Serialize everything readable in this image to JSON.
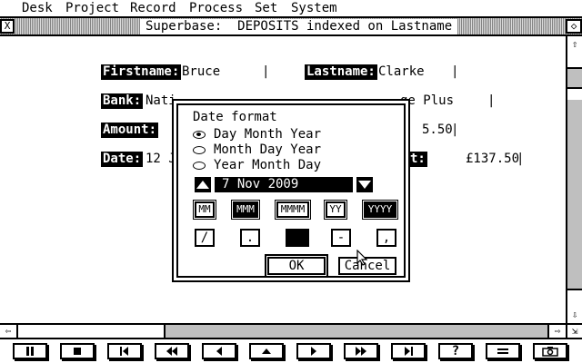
{
  "menubar": {
    "items": [
      "Desk",
      "Project",
      "Record",
      "Process",
      "Set",
      "System"
    ]
  },
  "window": {
    "title": "Superbase:  DEPOSITS indexed on Lastname",
    "close_glyph": "X",
    "full_glyph": "◇",
    "up_glyph": "⇧",
    "down_glyph": "⇩",
    "left_glyph": "⇦",
    "right_glyph": "⇨",
    "resize_glyph": "⇲"
  },
  "form": {
    "firstname_label": "Firstname:",
    "firstname_value": "Bruce",
    "lastname_label": "Lastname:",
    "lastname_value": "Clarke",
    "bank_label": "Bank:",
    "bank_value": "Nati",
    "bank_value_tail": "ge Plus",
    "amount_label": "Amount:",
    "amount_value_tail": "5.50",
    "date_label": "Date:",
    "date_value": "12 J",
    "total_label_tail": "t:",
    "total_value": "£137.50",
    "separator": "|"
  },
  "dialog": {
    "title": "Date format",
    "options": [
      {
        "label": "Day Month Year",
        "selected": true
      },
      {
        "label": "Month Day Year",
        "selected": false
      },
      {
        "label": "Year Month Day",
        "selected": false
      }
    ],
    "preview": "7 Nov 2009",
    "month_formats": [
      "MM",
      "MMM",
      "MMMM"
    ],
    "selected_month_format": "MMM",
    "year_formats": [
      "YY",
      "YYYY"
    ],
    "selected_year_format": "YYYY",
    "separators": [
      "/",
      ".",
      " ",
      "-",
      ","
    ],
    "selected_separator": " ",
    "ok_label": "OK",
    "cancel_label": "Cancel"
  },
  "toolbar": {
    "buttons": [
      "pause",
      "stop",
      "first-record",
      "fast-rewind",
      "previous-record",
      "eject",
      "next-record",
      "fast-forward",
      "last-record",
      "help",
      "equals",
      "camera"
    ],
    "help_label": "?"
  }
}
